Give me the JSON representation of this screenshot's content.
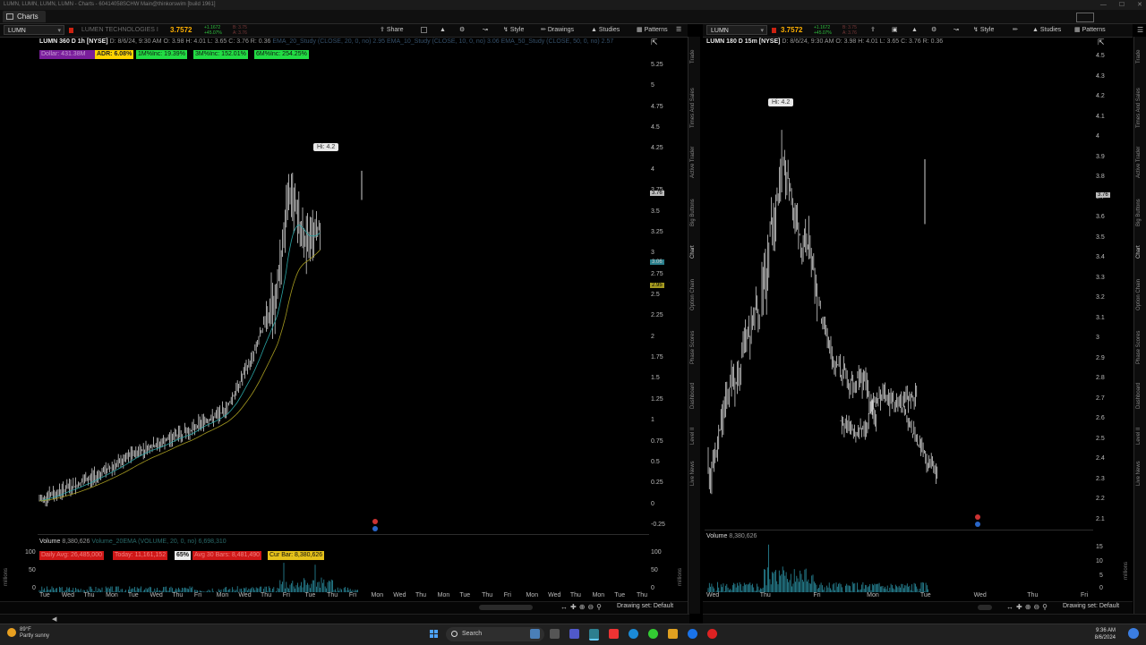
{
  "window": {
    "title": "LUMN, LUMN, LUMN, LUMN - Charts - 60414058SCHW Main@thinkorswim [build 1961]"
  },
  "tabs": [
    {
      "label": "Charts"
    }
  ],
  "left": {
    "toolbar": {
      "symbol": "LUMN",
      "company": "LUMEN TECHNOLOGIES I",
      "last": "3.7572",
      "change_line1": "+1.1672",
      "change_line2": "+45.07%",
      "bid": "B: 3.75",
      "ask": "A: 3.76",
      "share": "Share",
      "style": "Style",
      "drawings": "Drawings",
      "studies": "Studies",
      "patterns": "Patterns"
    },
    "headline": {
      "title": "LUMN 360 D 1h [NYSE]",
      "info": "D: 8/6/24, 9:30 AM  O: 3.98  H: 4.01  L: 3.65  C: 3.76  R: 0.36",
      "studies": "EMA_20_Study (CLOSE, 20, 0, no)  2.95  EMA_10_Study (CLOSE, 10, 0, no)  3.06  EMA_50_Study (CLOSE, 50, 0, no)  2.57"
    },
    "badges": {
      "dollar": "Dollar: 431.38M",
      "adr": "ADR: 6.08%",
      "inc1m": "1M%Inc: 19.39%",
      "inc3m": "3M%Inc: 152.01%",
      "inc6m": "6M%Inc: 254.25%"
    },
    "hi_label": "Hi: 4.2",
    "y_ticks": [
      "5.25",
      "5",
      "4.75",
      "4.5",
      "4.25",
      "4",
      "3.75",
      "3.5",
      "3.25",
      "3",
      "2.75",
      "2.5",
      "2.25",
      "2",
      "1.75",
      "1.5",
      "1.25",
      "1",
      "0.75",
      "0.5",
      "0.25",
      "0",
      "-0.25"
    ],
    "price_markers": [
      "3.76",
      "3.06",
      "2.95"
    ],
    "volume": {
      "label": "Volume",
      "value": "8,380,626",
      "study": "Volume_20EMA (VOLUME, 20, 0, no)  6,698,310",
      "daily_avg": "Daily Avg: 26,485,000",
      "today": "Today: 11,161,152",
      "pct": "65%",
      "avg_bars": "Avg 30 Bars: 8,481,490",
      "cur_bar": "Cur Bar: 8,380,626",
      "y_ticks": [
        "100",
        "50",
        "0"
      ],
      "unit": "millions"
    },
    "x_ticks": [
      "Tue",
      "Wed",
      "Thu",
      "Mon",
      "Tue",
      "Wed",
      "Thu",
      "Fri",
      "Mon",
      "Wed",
      "Thu",
      "Fri",
      "Tue",
      "Thu",
      "Fri",
      "Mon",
      "Wed",
      "Thu",
      "Mon",
      "Tue",
      "Thu",
      "Fri",
      "Mon",
      "Wed",
      "Thu",
      "Mon",
      "Tue",
      "Thu"
    ],
    "drawing_set": "Drawing set: Default"
  },
  "right": {
    "toolbar": {
      "symbol": "LUMN",
      "last": "3.7572",
      "change_line1": "+1.1672",
      "change_line2": "+45.07%",
      "bid": "B: 3.75",
      "ask": "A: 3.76",
      "style": "Style",
      "studies": "Studies",
      "patterns": "Patterns"
    },
    "headline": {
      "title": "LUMN 180 D 15m [NYSE]",
      "info": "D: 8/6/24, 9:30 AM  O: 3.98  H: 4.01  L: 3.65  C: 3.76  R: 0.36"
    },
    "hi_label": "Hi: 4.2",
    "y_ticks": [
      "4.5",
      "4.3",
      "4.2",
      "4.1",
      "4",
      "3.9",
      "3.8",
      "3.7",
      "3.6",
      "3.5",
      "3.4",
      "3.3",
      "3.2",
      "3.1",
      "3",
      "2.9",
      "2.8",
      "2.7",
      "2.6",
      "2.5",
      "2.4",
      "2.3",
      "2.2",
      "2.1"
    ],
    "price_marker": "3.76",
    "volume": {
      "label": "Volume",
      "value": "8,380,626",
      "y_ticks": [
        "15",
        "10",
        "5",
        "0"
      ],
      "unit": "millions"
    },
    "x_ticks": [
      "Wed",
      "Thu",
      "Fri",
      "Mon",
      "Tue",
      "Wed",
      "Thu",
      "Fri"
    ],
    "drawing_set": "Drawing set: Default"
  },
  "sidebar_tabs": [
    "Trade",
    "Times And Sales",
    "Active Trader",
    "Big Buttons",
    "Chart",
    "Option Chain",
    "Phase Scores",
    "Dashboard",
    "Level II",
    "Live News"
  ],
  "taskbar": {
    "weather_temp": "89°F",
    "weather_desc": "Partly sunny",
    "search": "Search",
    "time": "9:36 AM",
    "date": "8/6/2024"
  },
  "colors": {
    "price": "#ffb000",
    "up": "#2fbf3f",
    "down": "#e02020",
    "adr_badge": "#ffd400",
    "inc_badge": "#22dd44",
    "dollar_badge": "#7a1e9c",
    "ema_teal": "#2aa4a4",
    "ema_yellow": "#a59a20"
  }
}
